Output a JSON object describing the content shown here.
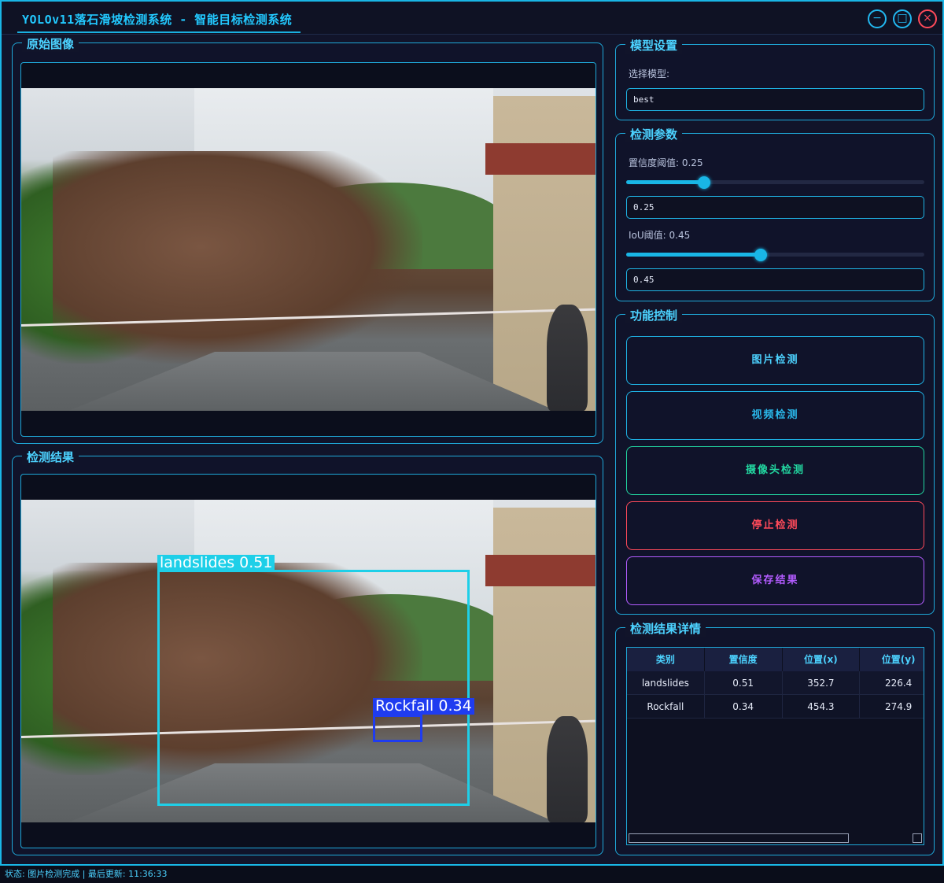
{
  "window": {
    "title": "YOLOv11落石滑坡检测系统 - 智能目标检测系统",
    "minimize_glyph": "−",
    "maximize_glyph": "□",
    "close_glyph": "×"
  },
  "original_panel": {
    "title": "原始图像"
  },
  "result_panel": {
    "title": "检测结果",
    "detections": [
      {
        "label": "landslides 0.51",
        "color": "#1ecfe8"
      },
      {
        "label": "Rockfall 0.34",
        "color": "#1f3cf0"
      }
    ]
  },
  "model_settings": {
    "title": "模型设置",
    "select_label": "选择模型:",
    "model_value": "best"
  },
  "params": {
    "title": "检测参数",
    "conf_label": "置信度阈值: 0.25",
    "conf_value": "0.25",
    "iou_label": "IoU阈值: 0.45",
    "iou_value": "0.45"
  },
  "controls": {
    "title": "功能控制",
    "image_detect": "图片检测",
    "video_detect": "视频检测",
    "camera_detect": "摄像头检测",
    "stop_detect": "停止检测",
    "save_result": "保存结果"
  },
  "results_detail": {
    "title": "检测结果详情",
    "columns": [
      "类别",
      "置信度",
      "位置(x)",
      "位置(y)"
    ],
    "rows": [
      [
        "landslides",
        "0.51",
        "352.7",
        "226.4"
      ],
      [
        "Rockfall",
        "0.34",
        "454.3",
        "274.9"
      ]
    ]
  },
  "status": {
    "text": "状态: 图片检测完成 | 最后更新: 11:36:33"
  },
  "colors": {
    "accent": "#19b6e6",
    "stop": "#ff4a5a",
    "camera": "#22d6a0",
    "save": "#b35cff"
  }
}
